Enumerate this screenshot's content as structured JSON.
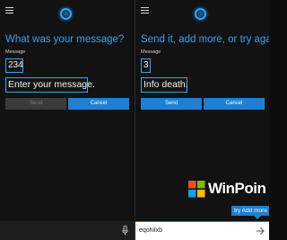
{
  "left_panel": {
    "title": "What was your message?",
    "field_label": "Message",
    "number_value": "234",
    "message_value": "Enter your message.",
    "send_label": "Send",
    "cancel_label": "Cancel"
  },
  "right_panel": {
    "title": "Send it, add more, or try again?",
    "field_label": "Message",
    "number_value": "3",
    "message_value": "Info death.",
    "send_label": "Send",
    "cancel_label": "Cancel",
    "suggestion": "try Add more",
    "input_value": "eqohilxb"
  },
  "watermark": {
    "text": "WinPoin"
  },
  "colors": {
    "accent": "#1d80d2",
    "title_blue": "#3aa3ea",
    "background": "#121212"
  },
  "icons": [
    "hamburger-menu-icon",
    "cortana-icon",
    "microphone-icon",
    "send-arrow-icon",
    "winpoin-logo-icon"
  ]
}
